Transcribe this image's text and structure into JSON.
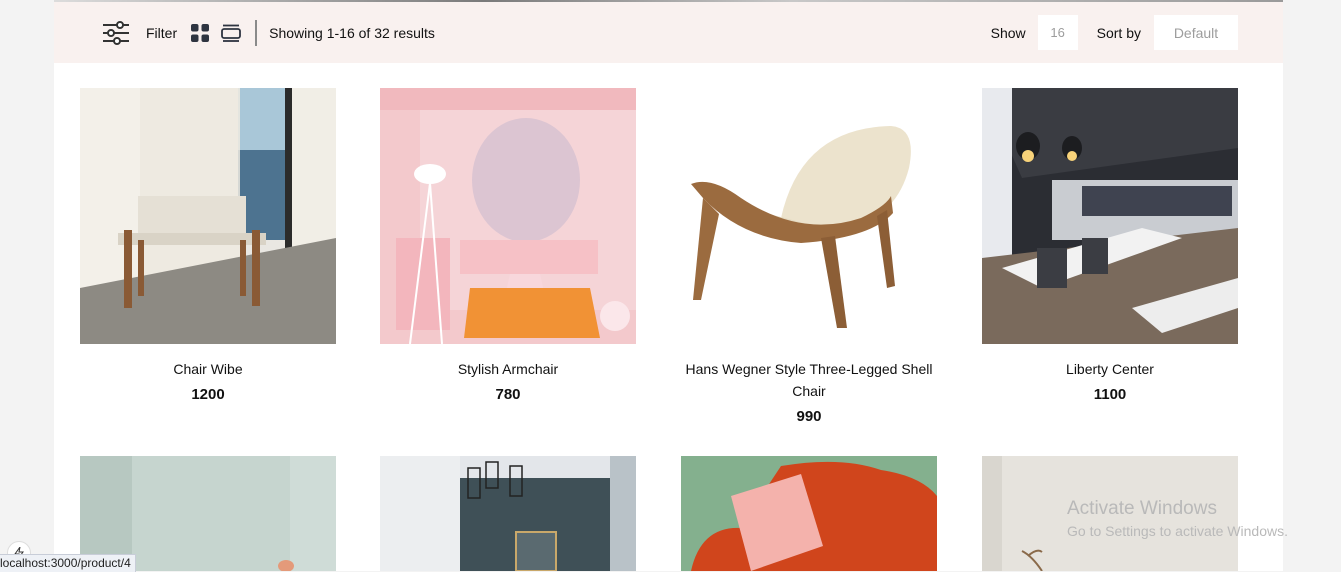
{
  "toolbar": {
    "filter_label": "Filter",
    "results_text": "Showing 1-16 of 32 results",
    "show_label": "Show",
    "show_value": "16",
    "sort_label": "Sort by",
    "sort_value": "Default",
    "icons": [
      "sliders-icon",
      "grid-view-icon",
      "list-view-icon"
    ]
  },
  "products": [
    {
      "name": "Chair Wibe",
      "price": "1200",
      "image": "white-woven-bench-by-window"
    },
    {
      "name": "Stylish Armchair",
      "price": "780",
      "image": "pink-room-with-lamp-and-table"
    },
    {
      "name": "Hans Wegner Style Three-Legged Shell Chair",
      "price": "990",
      "image": "cream-shell-chair-wood"
    },
    {
      "name": "Liberty Center",
      "price": "1100",
      "image": "modern-office-interior"
    },
    {
      "name": "",
      "price": "",
      "image": "mint-wall-with-pendant-lamp"
    },
    {
      "name": "",
      "price": "",
      "image": "teal-room-with-cage-pendants"
    },
    {
      "name": "",
      "price": "",
      "image": "orange-armchair-pink-pillow"
    },
    {
      "name": "",
      "price": "",
      "image": "grey-wall-with-plant"
    }
  ],
  "os_overlay": {
    "activate_title": "Activate Windows",
    "activate_sub": "Go to Settings to activate Windows.",
    "status_url": "localhost:3000/product/4"
  }
}
